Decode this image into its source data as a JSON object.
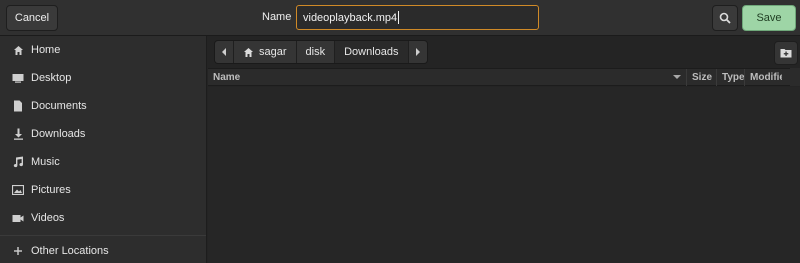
{
  "header": {
    "cancel_label": "Cancel",
    "name_label": "Name",
    "filename_value": "videoplayback.mp4",
    "save_label": "Save"
  },
  "sidebar": {
    "items": [
      {
        "label": "Home",
        "icon": "home-icon"
      },
      {
        "label": "Desktop",
        "icon": "desktop-icon"
      },
      {
        "label": "Documents",
        "icon": "document-icon"
      },
      {
        "label": "Downloads",
        "icon": "download-icon"
      },
      {
        "label": "Music",
        "icon": "music-icon"
      },
      {
        "label": "Pictures",
        "icon": "picture-icon"
      },
      {
        "label": "Videos",
        "icon": "video-icon"
      },
      {
        "label": "Other Locations",
        "icon": "plus-icon"
      }
    ]
  },
  "pathbar": {
    "crumbs": [
      "sagar",
      "disk",
      "Downloads"
    ]
  },
  "columns": {
    "name": "Name",
    "size": "Size",
    "type": "Type",
    "modified": "Modified"
  },
  "colors": {
    "accent_focus": "#d08a27",
    "save_button": "#9ed5a6"
  }
}
